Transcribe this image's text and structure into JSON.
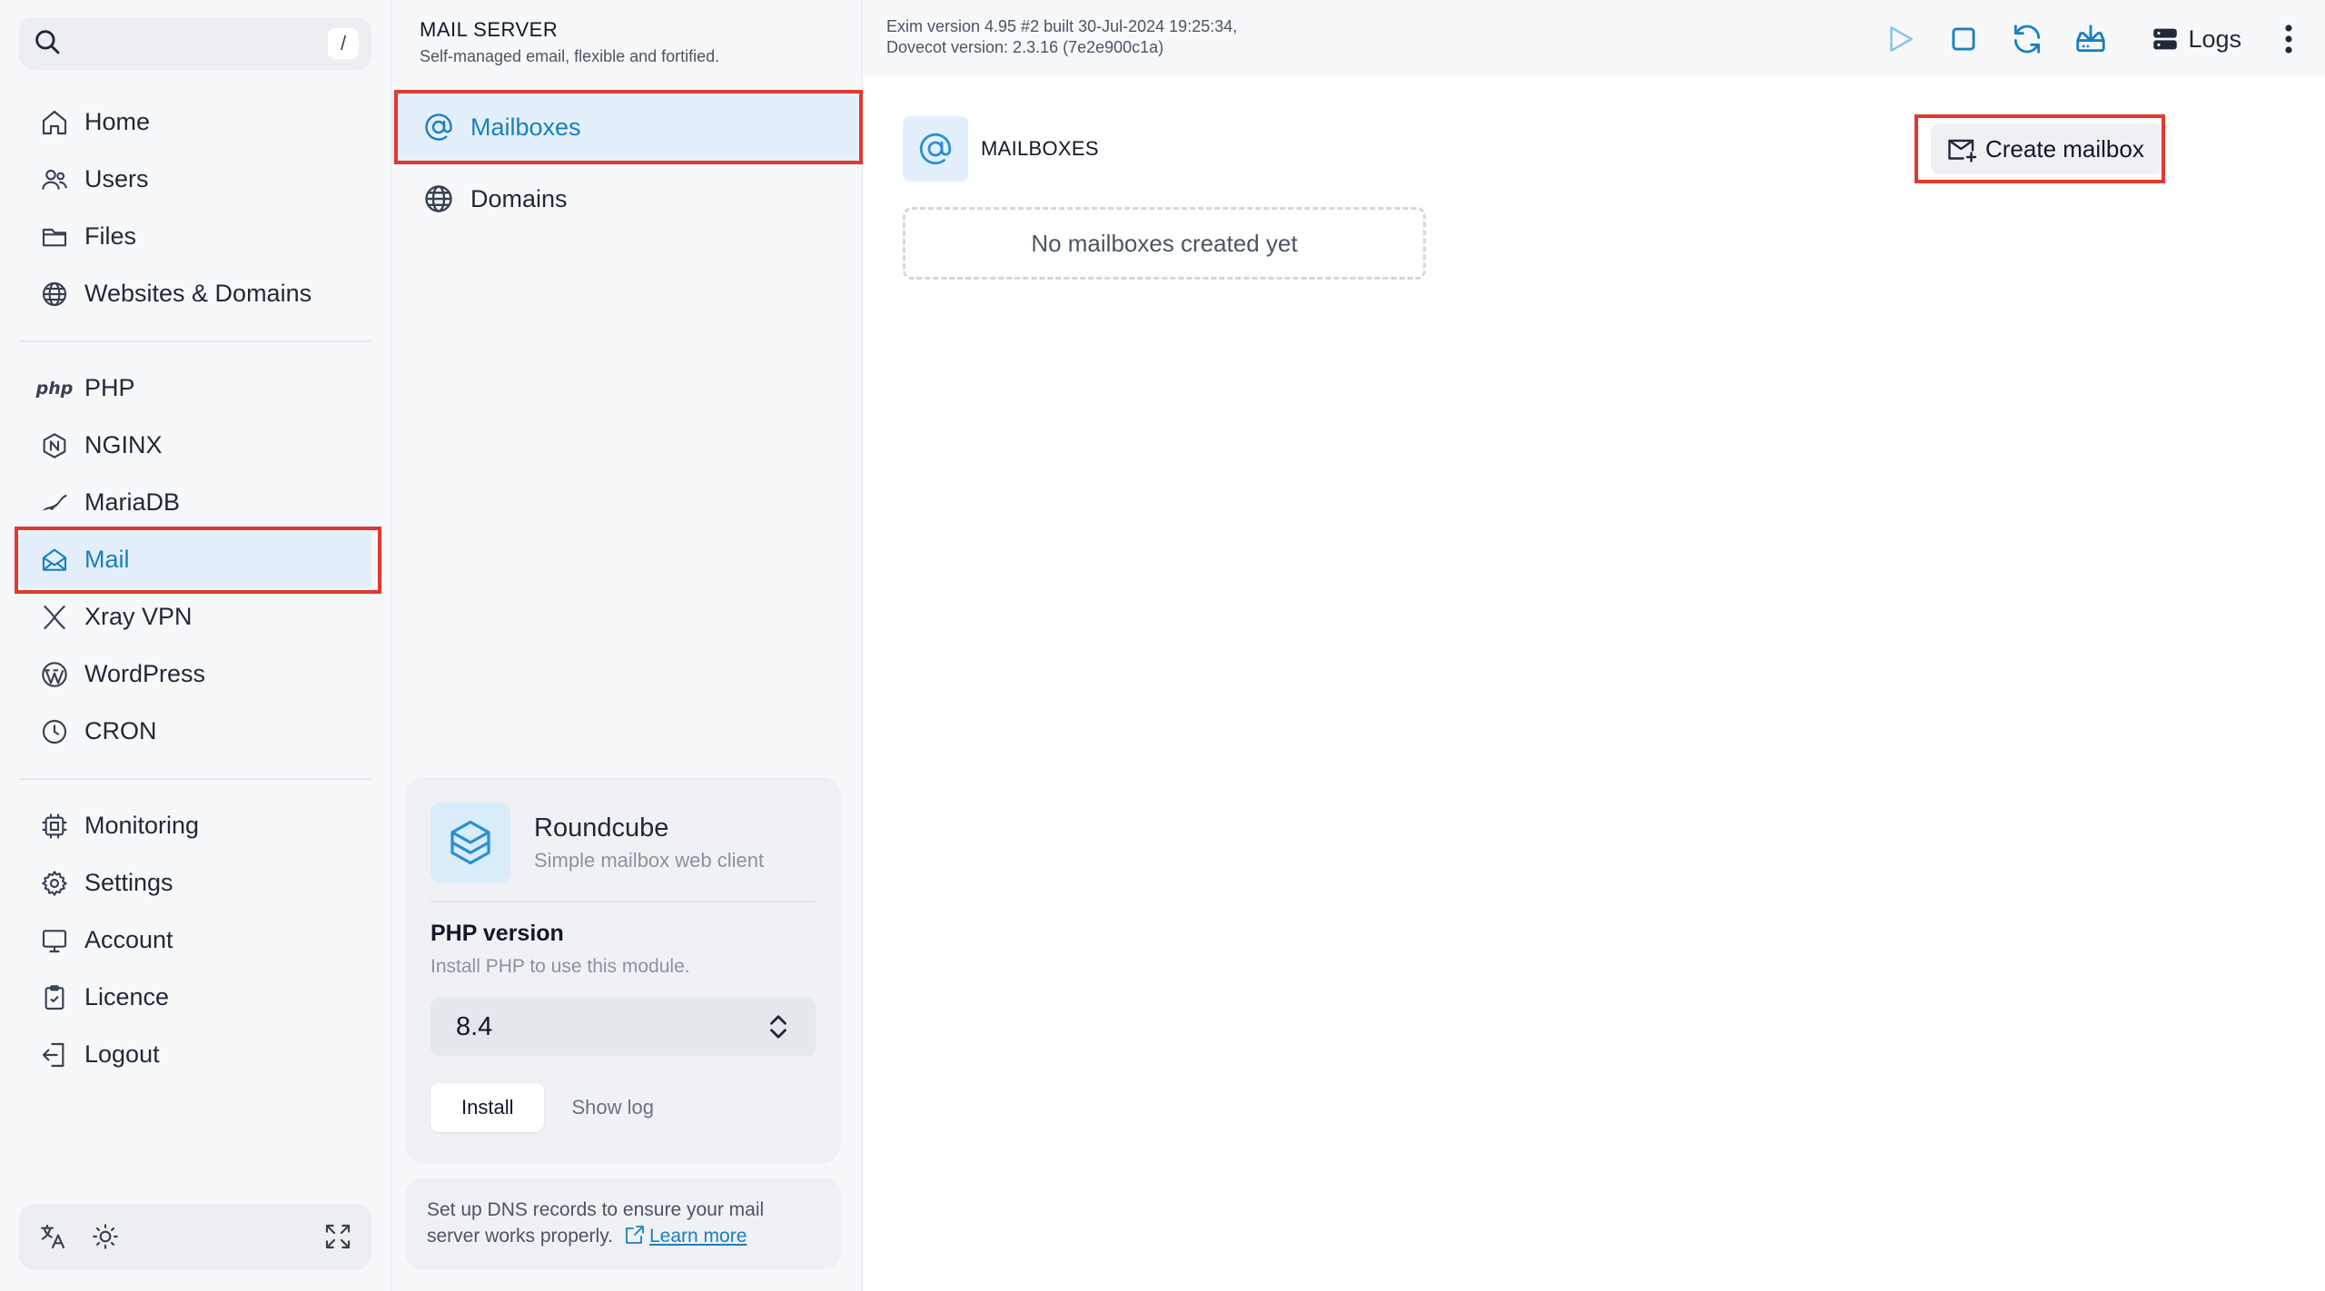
{
  "sidebar": {
    "search_shortcut": "/",
    "items_primary": [
      {
        "label": "Home",
        "icon": "home-icon"
      },
      {
        "label": "Users",
        "icon": "users-icon"
      },
      {
        "label": "Files",
        "icon": "folder-icon"
      },
      {
        "label": "Websites & Domains",
        "icon": "globe-icon"
      }
    ],
    "items_services": [
      {
        "label": "PHP",
        "icon": "php-icon",
        "icon_text": "php"
      },
      {
        "label": "NGINX",
        "icon": "nginx-icon"
      },
      {
        "label": "MariaDB",
        "icon": "mariadb-icon"
      },
      {
        "label": "Mail",
        "icon": "mail-icon",
        "active": true
      },
      {
        "label": "Xray VPN",
        "icon": "xray-icon"
      },
      {
        "label": "WordPress",
        "icon": "wordpress-icon"
      },
      {
        "label": "CRON",
        "icon": "clock-icon"
      }
    ],
    "items_system": [
      {
        "label": "Monitoring",
        "icon": "cpu-icon"
      },
      {
        "label": "Settings",
        "icon": "gear-icon"
      },
      {
        "label": "Account",
        "icon": "monitor-icon"
      },
      {
        "label": "Licence",
        "icon": "clipboard-icon"
      },
      {
        "label": "Logout",
        "icon": "logout-icon"
      }
    ]
  },
  "mail_server": {
    "title": "MAIL SERVER",
    "subtitle": "Self-managed email, flexible and fortified.",
    "menu": [
      {
        "label": "Mailboxes",
        "active": true
      },
      {
        "label": "Domains",
        "active": false
      }
    ],
    "roundcube": {
      "name": "Roundcube",
      "description": "Simple mailbox web client",
      "php_title": "PHP version",
      "php_note": "Install PHP to use this module.",
      "php_selected": "8.4",
      "install_label": "Install",
      "show_log_label": "Show log"
    },
    "dns_note": "Set up DNS records to ensure your mail server works properly.",
    "learn_more": "Learn more"
  },
  "topbar": {
    "version_line1": "Exim version 4.95 #2 built 30-Jul-2024 19:25:34,",
    "version_line2": "Dovecot version: 2.3.16 (7e2e900c1a)",
    "logs_label": "Logs"
  },
  "main": {
    "section_title": "MAILBOXES",
    "create_label": "Create mailbox",
    "empty_text": "No mailboxes created yet"
  },
  "colors": {
    "accent": "#1a7fc1",
    "highlight_border": "#e03a2f",
    "active_bg": "#e3f0fb"
  }
}
